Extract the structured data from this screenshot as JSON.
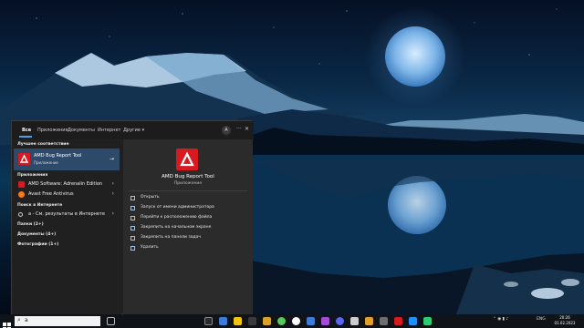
{
  "menu": {
    "tabs": [
      "Все",
      "Приложения",
      "Документы",
      "Интернет",
      "Другие"
    ],
    "more_tab_chevron": "▾",
    "avatar_letter": "A",
    "more_icon": "···",
    "close_icon": "✕"
  },
  "left": {
    "best_match_heading": "Лучшее соответствие",
    "best_match": {
      "title": "AMD Bug Report Tool",
      "subtitle": "Приложение",
      "arrow": "→"
    },
    "apps_heading": "Приложения",
    "apps": [
      {
        "label": "AMD Software: Adrenalin Edition",
        "icon_color": "#d71920"
      },
      {
        "label": "Avast Free Antivirus",
        "icon_color": "#f47b20"
      }
    ],
    "web_heading": "Поиск в Интернете",
    "web_result": "a - См. результаты в Интернете",
    "folders": "Папки (2+)",
    "documents": "Документы (4+)",
    "photos": "Фотографии (1+)",
    "chevron": "›"
  },
  "detail": {
    "title": "AMD Bug Report Tool",
    "subtitle": "Приложение",
    "actions": [
      "Открыть",
      "Запуск от имени администратора",
      "Перейти к расположению файла",
      "Закрепить на начальном экране",
      "Закрепить на панели задач",
      "Удалить"
    ]
  },
  "taskbar": {
    "search_value": "a",
    "search_icon": "⌕",
    "lang": "ENG",
    "time": "20:26",
    "date": "01.02.2023",
    "icon_colors": [
      "#2b2b2b",
      "#3c7bd8",
      "#f1c40f",
      "#3a3a3a",
      "#d7a32b",
      "#58c95b",
      "#ffffff",
      "#3c7bd8",
      "#a24bd6",
      "#5865f2",
      "#cccccc",
      "#e0a030",
      "#6e6e6e",
      "#d71920",
      "#1e90ff",
      "#2ecc71"
    ]
  },
  "colors": {
    "accent": "#4aa0e6",
    "amd_red": "#d71920",
    "selection": "#2d4a6a"
  }
}
